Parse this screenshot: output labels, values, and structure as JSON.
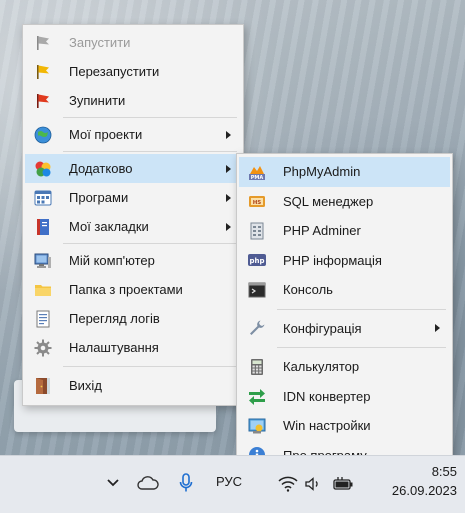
{
  "main_menu": {
    "items": [
      {
        "label": "Запустити",
        "icon": "start-flag-icon",
        "disabled": true
      },
      {
        "label": "Перезапустити",
        "icon": "restart-flag-icon"
      },
      {
        "label": "Зупинити",
        "icon": "stop-flag-icon"
      },
      {
        "label": "Мої проекти",
        "icon": "globe-icon",
        "submenu": true
      },
      {
        "label": "Додатково",
        "icon": "extras-icon",
        "submenu": true,
        "highlighted": true
      },
      {
        "label": "Програми",
        "icon": "apps-icon",
        "submenu": true
      },
      {
        "label": "Мої закладки",
        "icon": "bookmark-icon",
        "submenu": true
      },
      {
        "label": "Мій комп'ютер",
        "icon": "computer-icon"
      },
      {
        "label": "Папка з проектами",
        "icon": "folder-icon"
      },
      {
        "label": "Перегляд логів",
        "icon": "log-icon"
      },
      {
        "label": "Налаштування",
        "icon": "gear-icon"
      },
      {
        "label": "Вихід",
        "icon": "exit-icon"
      }
    ]
  },
  "sub_menu": {
    "items": [
      {
        "label": "PhpMyAdmin",
        "icon": "phpmyadmin-icon",
        "highlighted": true
      },
      {
        "label": "SQL менеджер",
        "icon": "sql-manager-icon"
      },
      {
        "label": "PHP Adminer",
        "icon": "adminer-icon"
      },
      {
        "label": "PHP інформація",
        "icon": "php-info-icon"
      },
      {
        "label": "Консоль",
        "icon": "console-icon"
      },
      {
        "label": "Конфігурація",
        "icon": "wrench-icon",
        "submenu": true
      },
      {
        "label": "Калькулятор",
        "icon": "calculator-icon"
      },
      {
        "label": "IDN конвертер",
        "icon": "idn-converter-icon"
      },
      {
        "label": "Win настройки",
        "icon": "win-settings-icon"
      },
      {
        "label": "Про програму",
        "icon": "info-icon"
      }
    ]
  },
  "taskbar": {
    "language": "РУС",
    "time": "8:55",
    "date": "26.09.2023"
  },
  "colors": {
    "highlight": "#cce4f7",
    "menu_bg": "#f3f3f3"
  }
}
